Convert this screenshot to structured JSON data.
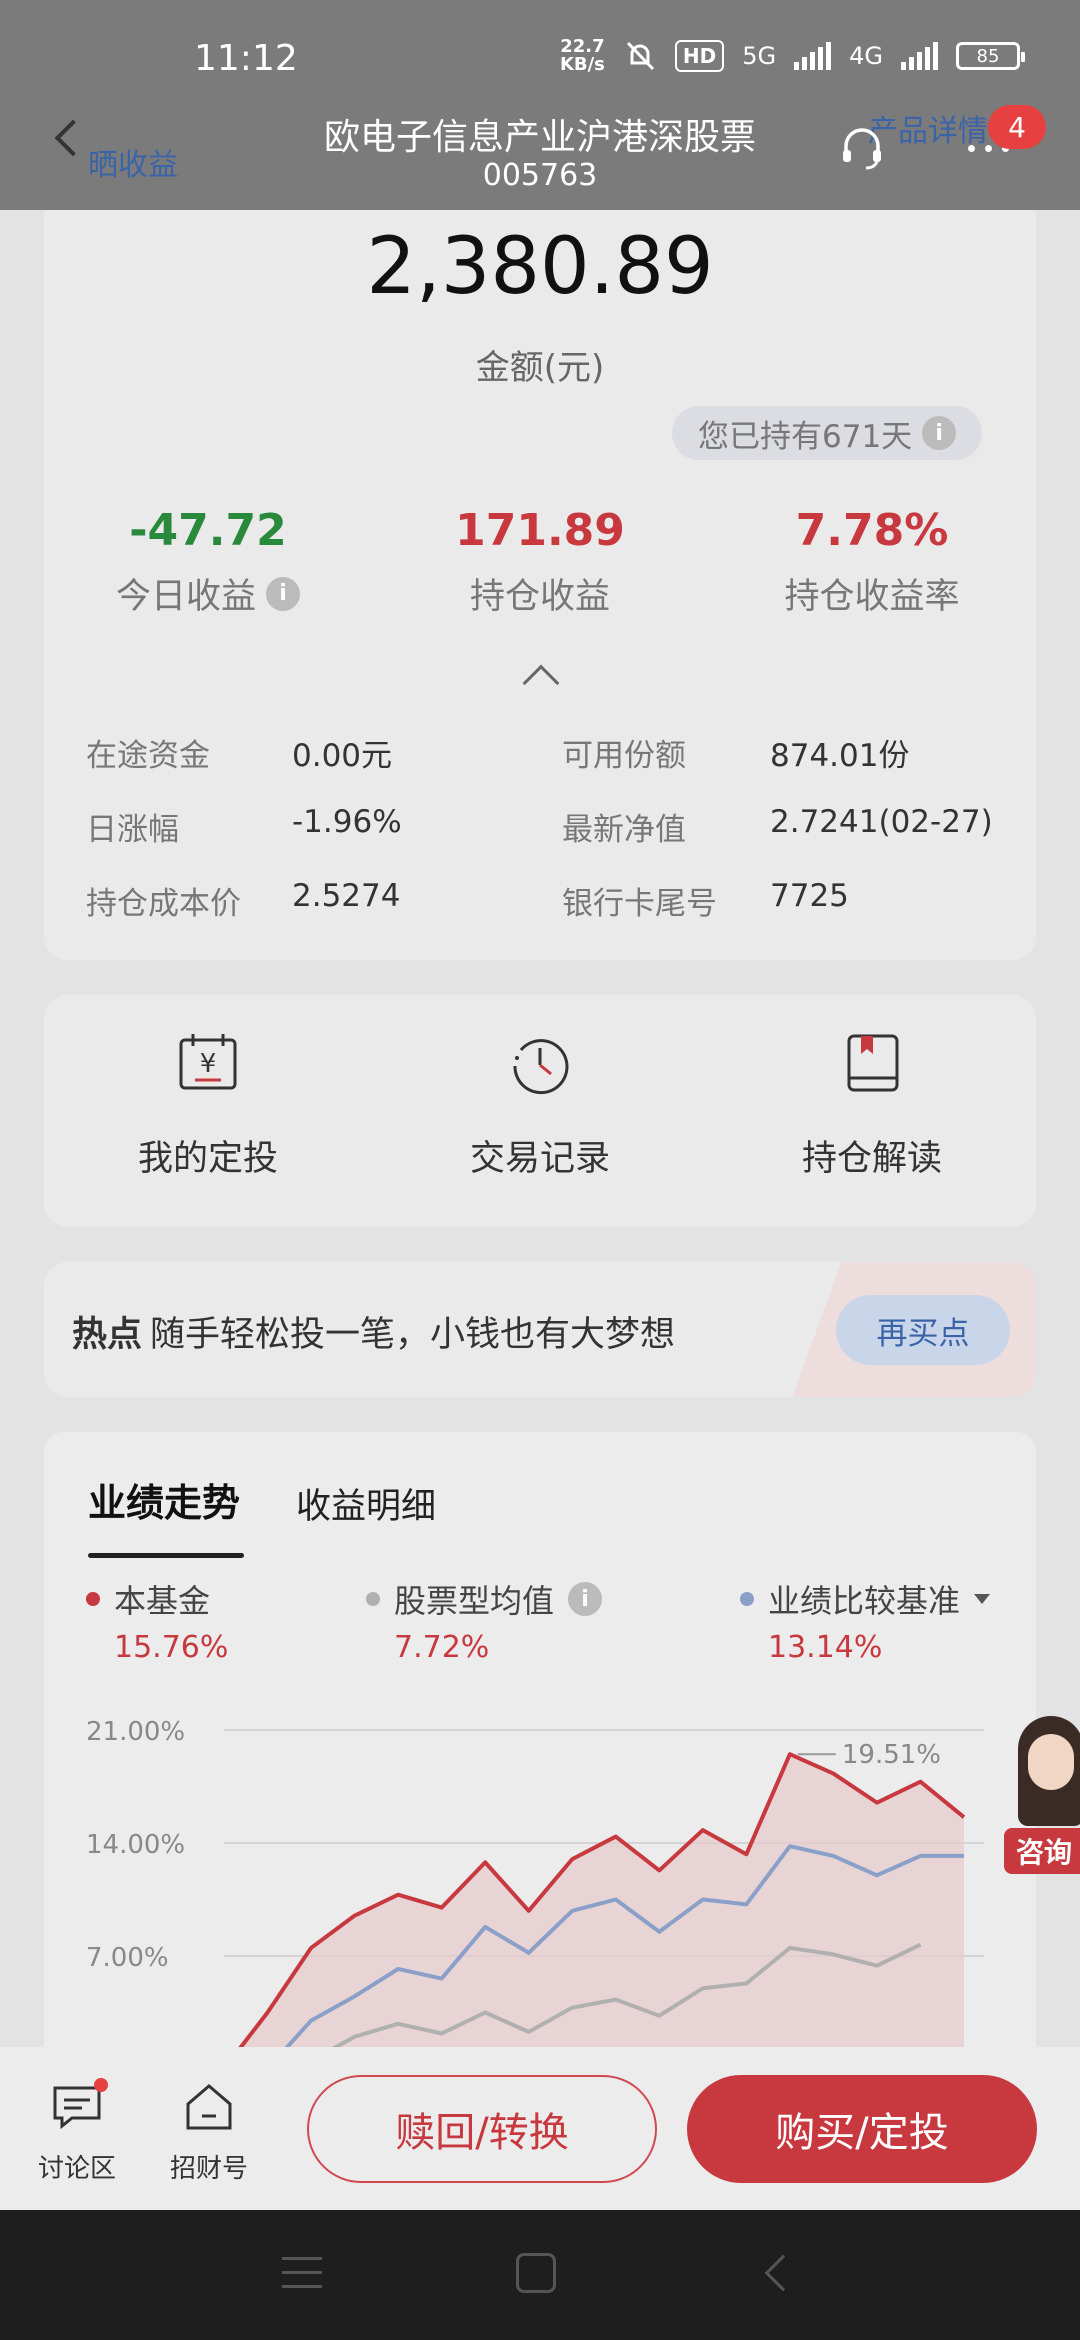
{
  "status_bar": {
    "time": "11:12",
    "net_speed_value": "22.7",
    "net_speed_unit": "KB/s",
    "hd_label": "HD",
    "network_5g": "5G",
    "network_4g": "4G",
    "battery": "85"
  },
  "header": {
    "back_label": "晒收益",
    "title": "欧电子信息产业沪港深股票",
    "code": "005763",
    "product_detail": "产品详情",
    "badge_count": "4"
  },
  "summary": {
    "amount": "2,380.89",
    "amount_label": "金额(元)",
    "held_days": "您已持有671天",
    "info_glyph": "i",
    "today": {
      "value": "-47.72",
      "label": "今日收益"
    },
    "position": {
      "value": "171.89",
      "label": "持仓收益"
    },
    "rate": {
      "value": "7.78%",
      "label": "持仓收益率"
    }
  },
  "details": [
    {
      "key": "在途资金",
      "value": "0.00元"
    },
    {
      "key": "可用份额",
      "value": "874.01份"
    },
    {
      "key": "日涨幅",
      "value": "-1.96%"
    },
    {
      "key": "最新净值",
      "value": "2.7241(02-27)"
    },
    {
      "key": "持仓成本价",
      "value": "2.5274"
    },
    {
      "key": "银行卡尾号",
      "value": "7725"
    }
  ],
  "actions": [
    {
      "label": "我的定投",
      "icon": "calendar-yen-icon"
    },
    {
      "label": "交易记录",
      "icon": "history-clock-icon"
    },
    {
      "label": "持仓解读",
      "icon": "book-icon"
    }
  ],
  "banner": {
    "hot": "热点",
    "text": "随手轻松投一笔，小钱也有大梦想",
    "button": "再买点"
  },
  "chart_tabs": {
    "active": "业绩走势",
    "other": "收益明细"
  },
  "legend": [
    {
      "name": "本基金",
      "value": "15.76%",
      "color": "#c8383f"
    },
    {
      "name": "股票型均值",
      "value": "7.72%",
      "color": "#b0b0b0"
    },
    {
      "name": "业绩比较基准",
      "value": "13.14%",
      "color": "#8aa0c8"
    }
  ],
  "chart_data": {
    "type": "line",
    "yticks": [
      "21.00%",
      "14.00%",
      "7.00%"
    ],
    "ylim": [
      0,
      21
    ],
    "peak_label": "19.51%",
    "series": [
      {
        "name": "本基金",
        "color": "#c8383f",
        "values": [
          0,
          3.5,
          7.5,
          9.5,
          10.8,
          10.0,
          12.8,
          9.8,
          13.0,
          14.4,
          12.3,
          14.8,
          13.3,
          19.5,
          18.3,
          16.5,
          17.8,
          15.6
        ]
      },
      {
        "name": "业绩比较基准",
        "color": "#8aa0c8",
        "values": [
          -0.5,
          0,
          3.0,
          4.5,
          6.2,
          5.6,
          8.8,
          7.2,
          9.8,
          10.5,
          8.5,
          10.5,
          10.2,
          13.8,
          13.2,
          12.0,
          13.2,
          13.2
        ]
      },
      {
        "name": "股票型均值",
        "color": "#b0b0b0",
        "values": [
          null,
          null,
          0.5,
          2.0,
          2.8,
          2.2,
          3.5,
          2.3,
          3.8,
          4.3,
          3.3,
          5.0,
          5.3,
          7.5,
          7.1,
          6.4,
          7.7,
          null
        ]
      }
    ]
  },
  "consult": {
    "label": "咨询"
  },
  "bottom_bar": {
    "discuss": "讨论区",
    "zhaocai": "招财号",
    "redeem": "赎回/转换",
    "buy": "购买/定投"
  }
}
